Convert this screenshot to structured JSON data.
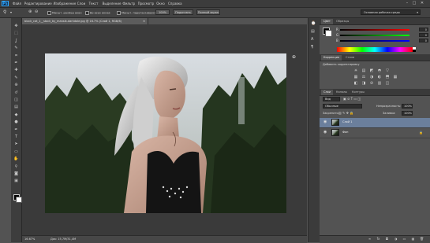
{
  "app": {
    "logo": "Ps"
  },
  "menu": {
    "items": [
      "Файл",
      "Редактирование",
      "Изображение",
      "Слои",
      "Текст",
      "Выделение",
      "Фильтр",
      "Просмотр",
      "Окно",
      "Справка"
    ],
    "window_controls": [
      "–",
      "□",
      "✕"
    ]
  },
  "options": {
    "auto_resize_label": "Масшт. размер окон",
    "all_windows_label": "Во всех окнах",
    "scrubby_label": "Масшт. перетаскиванием",
    "zoom_pct_label": "100%",
    "fit_label": "Подогнать",
    "fill_screen_label": "Полный экран",
    "workspace": "Основная рабочая среда"
  },
  "toolbar": {
    "tools": [
      "move-icon",
      "marquee-icon",
      "lasso-icon",
      "quick-select-icon",
      "crop-icon",
      "eyedropper-icon",
      "healing-icon",
      "brush-icon",
      "stamp-icon",
      "history-brush-icon",
      "eraser-icon",
      "gradient-icon",
      "blur-icon",
      "dodge-icon",
      "pen-icon",
      "type-icon",
      "path-select-icon",
      "shape-icon",
      "hand-icon",
      "zoom-icon",
      "quickmask-icon",
      "screenmode-icon"
    ],
    "tool_glyphs": [
      "✥",
      "⬚",
      "ʆ",
      "✎",
      "⌗",
      "✒",
      "✚",
      "✎",
      "⊕",
      "↺",
      "◫",
      "▤",
      "◆",
      "●",
      "✒",
      "T",
      "➤",
      "▭",
      "✋",
      "⚲",
      "◙",
      "▣"
    ],
    "fg_color": "#000000",
    "bg_color": "#ffffff"
  },
  "document": {
    "tab_title": "black_cat_1__stock_by_mansik-darkdole.jpg @ 16.7% (Слой 1, RGB/8)",
    "tab_close": "✕",
    "zoom": "16.67%",
    "doc_info": "Док: 15,7M/31,4M"
  },
  "panels": {
    "color": {
      "tabs": [
        "Цвет",
        "Образцы"
      ],
      "r_label": "R",
      "g_label": "G",
      "b_label": "B",
      "r": "0",
      "g": "0",
      "b": "0"
    },
    "adjustments": {
      "tabs": [
        "Коррекция",
        "Стили"
      ],
      "title": "Добавить корректировку",
      "icons_row1": [
        "☀",
        "▤",
        "◩",
        "◓",
        "▽"
      ],
      "icons_row2": [
        "▦",
        "⚖",
        "◑",
        "◐",
        "⬒",
        "▦"
      ],
      "icons_row3": [
        "◧",
        "◨",
        "⊘",
        "▥",
        "◫"
      ]
    },
    "layers": {
      "tabs": [
        "Слои",
        "Каналы",
        "Контуры"
      ],
      "filter_label": "Вид",
      "blend_mode": "Обычные",
      "opacity_label": "Непрозрачность:",
      "opacity_value": "100%",
      "lock_label": "Закрепить:",
      "fill_label": "Заливка:",
      "fill_value": "100%",
      "rows": [
        {
          "name": "Слой 1",
          "selected": true
        },
        {
          "name": "Фон",
          "selected": false
        }
      ],
      "footer_icons": [
        "∞",
        "fx",
        "◘",
        "◑",
        "▭",
        "▦",
        "🗑"
      ]
    }
  }
}
